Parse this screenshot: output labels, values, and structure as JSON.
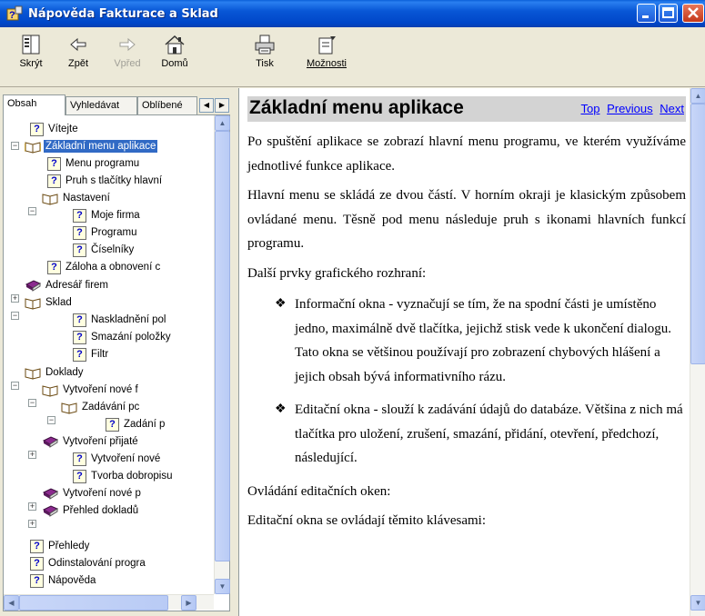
{
  "window": {
    "title": "Nápověda Fakturace a Sklad"
  },
  "toolbar": {
    "buttons": [
      {
        "label": "Skrýt",
        "icon": "hide-icon"
      },
      {
        "label": "Zpět",
        "icon": "back-arrow-icon"
      },
      {
        "label": "Vpřed",
        "icon": "forward-arrow-icon",
        "disabled": true
      },
      {
        "label": "Domů",
        "icon": "home-icon"
      },
      {
        "label": "Tisk",
        "icon": "printer-icon"
      },
      {
        "label": "Možnosti",
        "icon": "options-icon"
      }
    ]
  },
  "tabs": {
    "contents": "Obsah",
    "search": "Vyhledávat",
    "favorites": "Oblíbené"
  },
  "tree": [
    "Vítejte",
    "Základní menu aplikace",
    "Menu programu",
    "Pruh s tlačítky hlavní",
    "Nastavení",
    "Moje firma",
    "Programu",
    "Číselníky",
    "Záloha a obnovení c",
    "Adresář firem",
    "Sklad",
    "Naskladnění pol",
    "Smazání položky",
    "Filtr",
    "Doklady",
    "Vytvoření nové f",
    "Zadávání pc",
    "Zadání p",
    "Vytvoření přijaté",
    "Vytvoření nové",
    "Tvorba dobropisu",
    "Vytvoření nové p",
    "Přehled dokladů",
    "Přehledy",
    "Odinstalování progra",
    "Nápověda"
  ],
  "article": {
    "title": "Základní menu aplikace",
    "nav": {
      "top": "Top",
      "previous": "Previous",
      "next": "Next"
    },
    "p1": "Po spuštění aplikace se zobrazí hlavní menu programu, ve kterém využíváme jednotlivé funkce aplikace.",
    "p2": "Hlavní menu se skládá ze dvou částí. V horním okraji je klasickým způsobem ovládané menu. Těsně pod menu následuje pruh s ikonami hlavních funkcí programu.",
    "p3": "Další prvky grafického rozhraní:",
    "bullet1": "Informační okna - vyznačují se tím, že na spodní části je umístěno jedno, maximálně dvě tlačítka, jejichž stisk vede k ukončení dialogu. Tato okna se většinou používají pro zobrazení chybových hlášení a jejich obsah bývá informativního rázu.",
    "bullet2": "Editační okna - slouží k zadávání údajů do databáze. Většina z nich má tlačítka pro uložení, zrušení, smazání, přidání, otevření, předchozí, následující.",
    "p4": "Ovládání editačních oken:",
    "p5": "Editační okna se ovládají těmito klávesami:"
  }
}
